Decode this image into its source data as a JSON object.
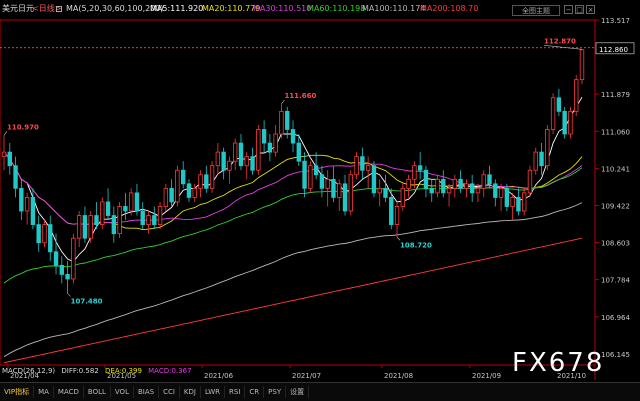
{
  "header": {
    "symbol": "美元日元",
    "period": "<日线>",
    "ma_params": "MA(5,20,30,60,100,200)",
    "ma_values": [
      {
        "label": "MA5:111.920",
        "color": "#ffffff"
      },
      {
        "label": "MA20:110.779",
        "color": "#e8e000"
      },
      {
        "label": "MA30:110.510",
        "color": "#e040e0"
      },
      {
        "label": "MA60:110.198",
        "color": "#30d030"
      },
      {
        "label": "MA100:110.174",
        "color": "#b8b8b8"
      },
      {
        "label": "MA200:108.70",
        "color": "#ff3a3a"
      }
    ],
    "theme_button": "全图主题",
    "window_buttons": [
      "−",
      "□",
      "×"
    ]
  },
  "chart_data": {
    "type": "candlestick",
    "y_axis_ticks": [
      113.517,
      112.86,
      111.879,
      111.06,
      110.241,
      109.422,
      108.603,
      107.784,
      106.964,
      106.145
    ],
    "current_price": "112.860",
    "x_axis_ticks": [
      "2021/04",
      "2021/05",
      "2021/06",
      "2021/07",
      "2021/08",
      "2021/09",
      "2021/10"
    ],
    "annotations": [
      {
        "label": "110.970",
        "kind": "high"
      },
      {
        "label": "107.480",
        "kind": "low"
      },
      {
        "label": "111.660",
        "kind": "high"
      },
      {
        "label": "108.720",
        "kind": "low"
      },
      {
        "label": "112.870",
        "kind": "high"
      }
    ],
    "series": [
      {
        "name": "MA5",
        "color": "#ffffff"
      },
      {
        "name": "MA20",
        "color": "#e8e000"
      },
      {
        "name": "MA30",
        "color": "#e040e0"
      },
      {
        "name": "MA60",
        "color": "#30d030"
      },
      {
        "name": "MA100",
        "color": "#b8b8b8"
      },
      {
        "name": "MA200",
        "color": "#ff3a3a"
      }
    ],
    "candles": [
      [
        110.5,
        110.97,
        110.2,
        110.6
      ],
      [
        110.6,
        110.8,
        110.1,
        110.3
      ],
      [
        110.3,
        110.5,
        109.6,
        109.8
      ],
      [
        109.8,
        110.0,
        109.1,
        109.3
      ],
      [
        109.3,
        109.7,
        109.0,
        109.6
      ],
      [
        109.6,
        109.8,
        108.9,
        109.0
      ],
      [
        109.0,
        109.2,
        108.4,
        108.6
      ],
      [
        108.6,
        109.1,
        108.5,
        109.0
      ],
      [
        109.0,
        109.2,
        108.2,
        108.4
      ],
      [
        108.4,
        108.8,
        107.9,
        108.1
      ],
      [
        108.1,
        108.3,
        107.7,
        107.9
      ],
      [
        107.9,
        108.2,
        107.48,
        107.8
      ],
      [
        107.8,
        108.8,
        107.7,
        108.7
      ],
      [
        108.7,
        109.3,
        108.5,
        109.2
      ],
      [
        109.2,
        109.4,
        108.6,
        108.7
      ],
      [
        108.7,
        109.3,
        108.6,
        109.2
      ],
      [
        109.2,
        109.5,
        108.9,
        109.0
      ],
      [
        109.0,
        109.6,
        108.9,
        109.5
      ],
      [
        109.5,
        109.8,
        109.1,
        109.2
      ],
      [
        109.2,
        109.4,
        108.6,
        108.8
      ],
      [
        108.8,
        109.5,
        108.7,
        109.4
      ],
      [
        109.4,
        109.7,
        109.1,
        109.3
      ],
      [
        109.3,
        109.8,
        109.2,
        109.7
      ],
      [
        109.7,
        109.9,
        109.2,
        109.3
      ],
      [
        109.3,
        109.5,
        108.9,
        109.0
      ],
      [
        109.0,
        109.3,
        108.8,
        109.2
      ],
      [
        109.2,
        109.4,
        108.9,
        109.0
      ],
      [
        109.0,
        109.5,
        108.9,
        109.4
      ],
      [
        109.4,
        109.9,
        109.3,
        109.8
      ],
      [
        109.8,
        110.0,
        109.4,
        109.5
      ],
      [
        109.5,
        110.3,
        109.4,
        110.2
      ],
      [
        110.2,
        110.4,
        109.8,
        109.9
      ],
      [
        109.9,
        110.0,
        109.5,
        109.6
      ],
      [
        109.6,
        109.9,
        109.5,
        109.8
      ],
      [
        109.8,
        110.2,
        109.6,
        110.1
      ],
      [
        110.1,
        110.3,
        109.7,
        109.8
      ],
      [
        109.8,
        110.4,
        109.7,
        110.3
      ],
      [
        110.3,
        110.8,
        110.1,
        110.6
      ],
      [
        110.6,
        110.7,
        110.0,
        110.2
      ],
      [
        110.2,
        110.5,
        109.9,
        110.4
      ],
      [
        110.4,
        110.9,
        110.2,
        110.8
      ],
      [
        110.8,
        111.0,
        110.2,
        110.3
      ],
      [
        110.3,
        110.6,
        110.0,
        110.5
      ],
      [
        110.5,
        110.7,
        110.1,
        110.2
      ],
      [
        110.2,
        111.2,
        110.1,
        111.1
      ],
      [
        111.1,
        111.3,
        110.6,
        110.8
      ],
      [
        110.8,
        111.0,
        110.4,
        110.6
      ],
      [
        110.6,
        111.2,
        110.5,
        111.0
      ],
      [
        111.0,
        111.66,
        110.9,
        111.5
      ],
      [
        111.5,
        111.6,
        110.9,
        111.1
      ],
      [
        111.1,
        111.3,
        110.6,
        110.8
      ],
      [
        110.8,
        111.0,
        110.3,
        110.4
      ],
      [
        110.4,
        110.6,
        109.6,
        109.8
      ],
      [
        109.8,
        110.4,
        109.7,
        110.3
      ],
      [
        110.3,
        110.6,
        110.0,
        110.1
      ],
      [
        110.1,
        110.3,
        109.6,
        109.8
      ],
      [
        109.8,
        110.2,
        109.4,
        110.0
      ],
      [
        110.0,
        110.3,
        109.5,
        109.6
      ],
      [
        109.6,
        110.0,
        109.3,
        109.9
      ],
      [
        109.9,
        110.1,
        109.2,
        109.3
      ],
      [
        109.3,
        110.2,
        109.2,
        110.1
      ],
      [
        110.1,
        110.6,
        110.0,
        110.5
      ],
      [
        110.5,
        110.7,
        110.0,
        110.2
      ],
      [
        110.2,
        110.5,
        109.8,
        110.3
      ],
      [
        110.3,
        110.4,
        109.6,
        109.7
      ],
      [
        109.7,
        110.0,
        109.4,
        109.8
      ],
      [
        109.8,
        110.1,
        109.5,
        109.6
      ],
      [
        109.6,
        109.8,
        108.9,
        109.0
      ],
      [
        109.0,
        109.5,
        108.72,
        109.4
      ],
      [
        109.4,
        109.9,
        109.3,
        109.8
      ],
      [
        109.8,
        110.1,
        109.6,
        110.0
      ],
      [
        110.0,
        110.4,
        109.8,
        110.3
      ],
      [
        110.3,
        110.6,
        110.0,
        110.2
      ],
      [
        110.2,
        110.3,
        109.6,
        109.8
      ],
      [
        109.8,
        110.0,
        109.5,
        109.7
      ],
      [
        109.7,
        110.1,
        109.6,
        110.0
      ],
      [
        110.0,
        110.2,
        109.6,
        109.7
      ],
      [
        109.7,
        109.9,
        109.4,
        109.8
      ],
      [
        109.8,
        110.1,
        109.6,
        110.0
      ],
      [
        110.0,
        110.2,
        109.7,
        109.8
      ],
      [
        109.8,
        110.0,
        109.6,
        109.9
      ],
      [
        109.9,
        110.1,
        109.5,
        109.7
      ],
      [
        109.7,
        109.9,
        109.5,
        109.8
      ],
      [
        109.8,
        110.2,
        109.6,
        110.1
      ],
      [
        110.1,
        110.3,
        109.8,
        109.9
      ],
      [
        109.9,
        110.0,
        109.4,
        109.6
      ],
      [
        109.6,
        109.9,
        109.3,
        109.8
      ],
      [
        109.8,
        109.9,
        109.3,
        109.4
      ],
      [
        109.4,
        109.7,
        109.1,
        109.6
      ],
      [
        109.6,
        109.8,
        109.2,
        109.3
      ],
      [
        109.3,
        109.8,
        109.2,
        109.7
      ],
      [
        109.7,
        110.3,
        109.6,
        110.2
      ],
      [
        110.2,
        110.7,
        110.1,
        110.6
      ],
      [
        110.6,
        110.8,
        110.1,
        110.3
      ],
      [
        110.3,
        111.2,
        110.2,
        111.1
      ],
      [
        111.1,
        111.9,
        111.0,
        111.8
      ],
      [
        111.8,
        112.0,
        111.4,
        111.5
      ],
      [
        111.5,
        111.6,
        110.9,
        111.0
      ],
      [
        111.0,
        111.6,
        110.9,
        111.5
      ],
      [
        111.5,
        112.3,
        111.4,
        112.2
      ],
      [
        112.2,
        112.87,
        112.1,
        112.86
      ]
    ]
  },
  "macd": {
    "label": "MACD(26,12,9)",
    "diff": "DIFF:0.582",
    "dea": "DEA:0.399",
    "macd": "MACD:0.367"
  },
  "tabs": [
    "VIP指标",
    "MA",
    "MACD",
    "BOLL",
    "VOL",
    "BIAS",
    "CCI",
    "KDJ",
    "LWR",
    "RSI",
    "CR",
    "PSY",
    "设置"
  ],
  "watermark": "FX678",
  "colors": {
    "up": "#ff3a3a",
    "down": "#20c8c8",
    "background": "#000000",
    "grid": "#b80000"
  }
}
